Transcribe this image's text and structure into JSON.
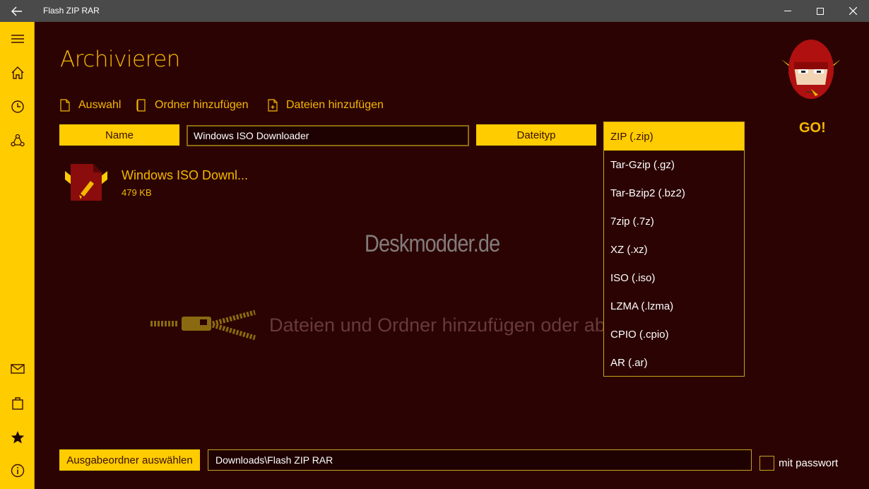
{
  "window": {
    "title": "Flash ZIP RAR",
    "back_icon": "back-arrow-icon"
  },
  "colors": {
    "accent": "#ffcc00",
    "background": "#2b0303",
    "text_accent": "#f5b800",
    "titlebar": "#4a4a4a"
  },
  "sidebar": {
    "items": [
      {
        "name": "hamburger-menu-icon"
      },
      {
        "name": "home-icon"
      },
      {
        "name": "history-clock-icon"
      },
      {
        "name": "share-icon"
      },
      {
        "name": "mail-icon"
      },
      {
        "name": "store-bag-icon"
      },
      {
        "name": "star-icon"
      },
      {
        "name": "info-icon"
      }
    ]
  },
  "main": {
    "page_title": "Archivieren",
    "commands": {
      "selection": "Auswahl",
      "add_folder": "Ordner hinzufügen",
      "add_files": "Dateien hinzufügen"
    },
    "name_label": "Name",
    "name_value": "Windows ISO Downloader",
    "type_label": "Dateityp",
    "file": {
      "name": "Windows ISO Downl...",
      "size": "479 KB"
    },
    "watermark": "Deskmodder.de",
    "empty_hint": "Dateien und Ordner hinzufügen oder ablegen hier"
  },
  "file_type_dropdown": {
    "selected": "ZIP (.zip)",
    "options": [
      "ZIP (.zip)",
      "Tar-Gzip (.gz)",
      "Tar-Bzip2 (.bz2)",
      "7zip (.7z)",
      "XZ (.xz)",
      "ISO (.iso)",
      "LZMA (.lzma)",
      "CPIO (.cpio)",
      "AR (.ar)"
    ]
  },
  "go_button": {
    "label": "GO!"
  },
  "output": {
    "choose_label": "Ausgabeordner auswählen",
    "path": "Downloads\\Flash ZIP RAR",
    "password_label": "mit passwort",
    "password_checked": false
  }
}
